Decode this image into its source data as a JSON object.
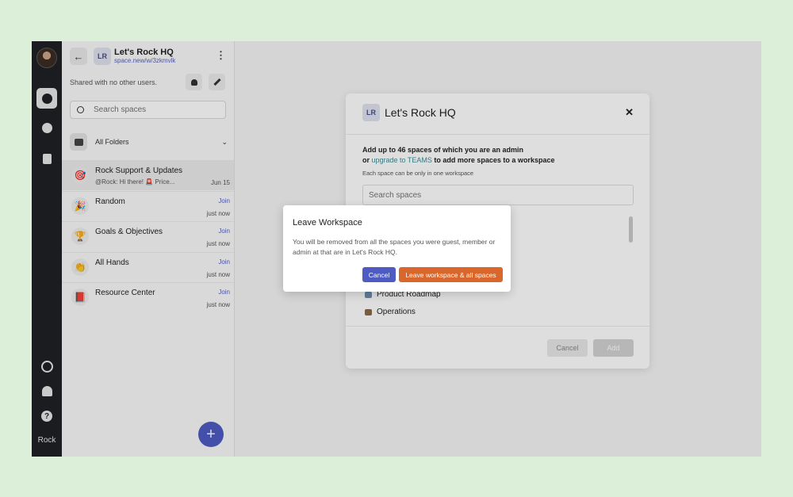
{
  "rail": {
    "icons": [
      "avatar",
      "chat-icon",
      "grid-icon",
      "document-icon",
      "clock-icon",
      "bell-icon",
      "help-icon"
    ],
    "help_glyph": "?",
    "brand": "Rock"
  },
  "sidebar": {
    "back_glyph": "←",
    "badge": "LR",
    "title": "Let's Rock HQ",
    "link": "space.new/w/3zkmvlk",
    "kebab": "⋮",
    "shared_text": "Shared with no other users.",
    "search_placeholder": "Search spaces",
    "folders_label": "All Folders",
    "folders_chevron": "⌄",
    "spaces": [
      {
        "name": "Rock Support & Updates",
        "sub": "@Rock: Hi there! 🚨 Price...",
        "time": "Jun 15",
        "join": "",
        "icon": "🎯",
        "selected": true
      },
      {
        "name": "Random",
        "sub": "",
        "time": "just now",
        "join": "Join",
        "icon": "🎉"
      },
      {
        "name": "Goals & Objectives",
        "sub": "",
        "time": "just now",
        "join": "Join",
        "icon": "🏆"
      },
      {
        "name": "All Hands",
        "sub": "",
        "time": "just now",
        "join": "Join",
        "icon": "👏"
      },
      {
        "name": "Resource Center",
        "sub": "",
        "time": "just now",
        "join": "Join",
        "icon": "📕"
      }
    ],
    "fab_label": "+"
  },
  "add_dialog": {
    "badge": "LR",
    "title": "Let's Rock HQ",
    "close_glyph": "✕",
    "line1": "Add up to 46 spaces of which you are an admin",
    "line2_prefix": "or ",
    "line2_link": "upgrade to TEAMS",
    "line2_suffix": " to add more spaces to a workspace",
    "note": "Each space can be only in one workspace",
    "search_placeholder": "Search spaces",
    "options": [
      {
        "label": "Product Roadmap",
        "color": "#6f8fb3"
      },
      {
        "label": "Operations",
        "color": "#8a6a4a"
      }
    ],
    "cancel_label": "Cancel",
    "add_label": "Add"
  },
  "confirm_modal": {
    "title": "Leave Workspace",
    "body": "You will be removed from all the spaces you were guest, member or admin at that are in Let's Rock HQ.",
    "cancel_label": "Cancel",
    "leave_label": "Leave workspace & all spaces",
    "colors": {
      "cancel": "#4d5bc2",
      "leave": "#d9662a"
    }
  }
}
